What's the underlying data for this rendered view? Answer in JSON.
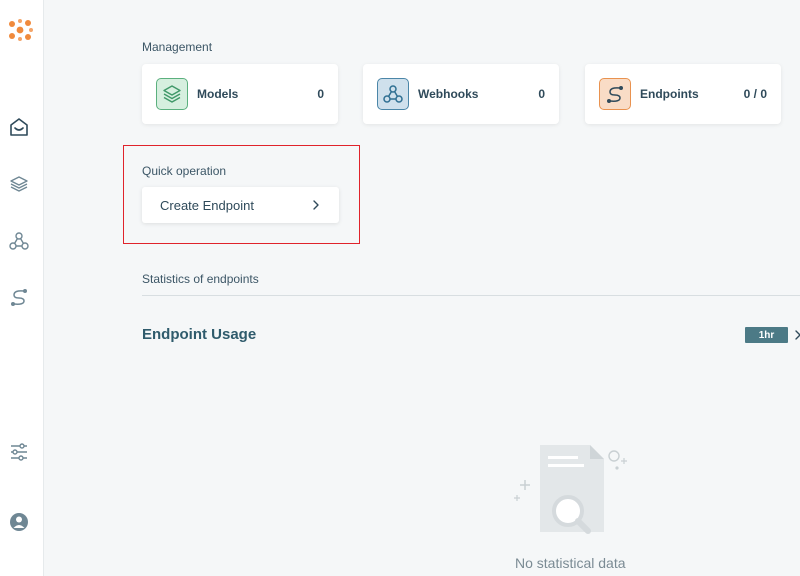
{
  "sidebar": {
    "icons": [
      "logo-icon",
      "home-icon",
      "models-icon",
      "webhooks-icon",
      "endpoints-icon",
      "settings-icon",
      "account-icon"
    ]
  },
  "management": {
    "label": "Management",
    "cards": [
      {
        "label": "Models",
        "count": "0",
        "icon": "layers-icon",
        "color": "#5bb07e",
        "bg": "#d6efdf"
      },
      {
        "label": "Webhooks",
        "count": "0",
        "icon": "webhook-icon",
        "color": "#4b86a8",
        "bg": "#cfe0ec"
      },
      {
        "label": "Endpoints",
        "count": "0 / 0",
        "icon": "endpoint-icon",
        "color": "#e9924f",
        "bg": "#f9dcc6"
      }
    ]
  },
  "quick_operation": {
    "label": "Quick operation",
    "button_label": "Create Endpoint"
  },
  "statistics": {
    "label": "Statistics of endpoints",
    "usage_title": "Endpoint Usage",
    "time_range": "1hr",
    "empty_text": "No statistical data"
  },
  "colors": {
    "accent_orange": "#f08a3c",
    "highlight_red": "#e0232b",
    "badge": "#4c7a86"
  }
}
